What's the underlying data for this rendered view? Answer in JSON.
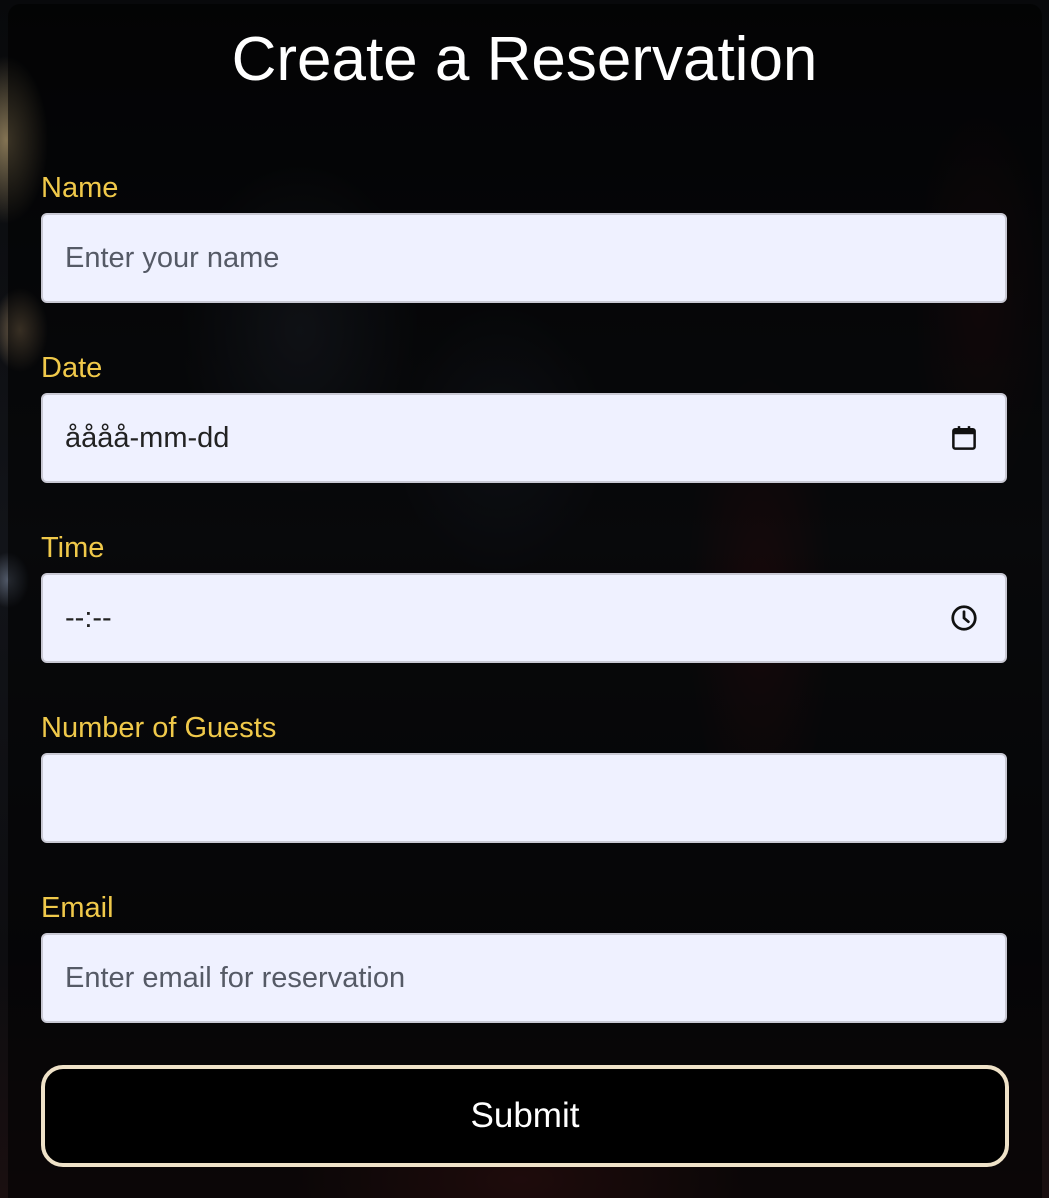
{
  "form": {
    "title": "Create a Reservation",
    "fields": {
      "name": {
        "label": "Name",
        "placeholder": "Enter your name",
        "value": ""
      },
      "date": {
        "label": "Date",
        "display": "åååå-mm-dd",
        "icon": "calendar-icon"
      },
      "time": {
        "label": "Time",
        "display": "--:--",
        "icon": "clock-icon"
      },
      "guests": {
        "label": "Number of Guests",
        "value": ""
      },
      "email": {
        "label": "Email",
        "placeholder": "Enter email for reservation",
        "value": ""
      }
    },
    "submit_label": "Submit"
  },
  "colors": {
    "label": "#f0c94a",
    "input_background": "#eff1ff",
    "button_background": "#000000",
    "button_border": "#efe2c8"
  }
}
